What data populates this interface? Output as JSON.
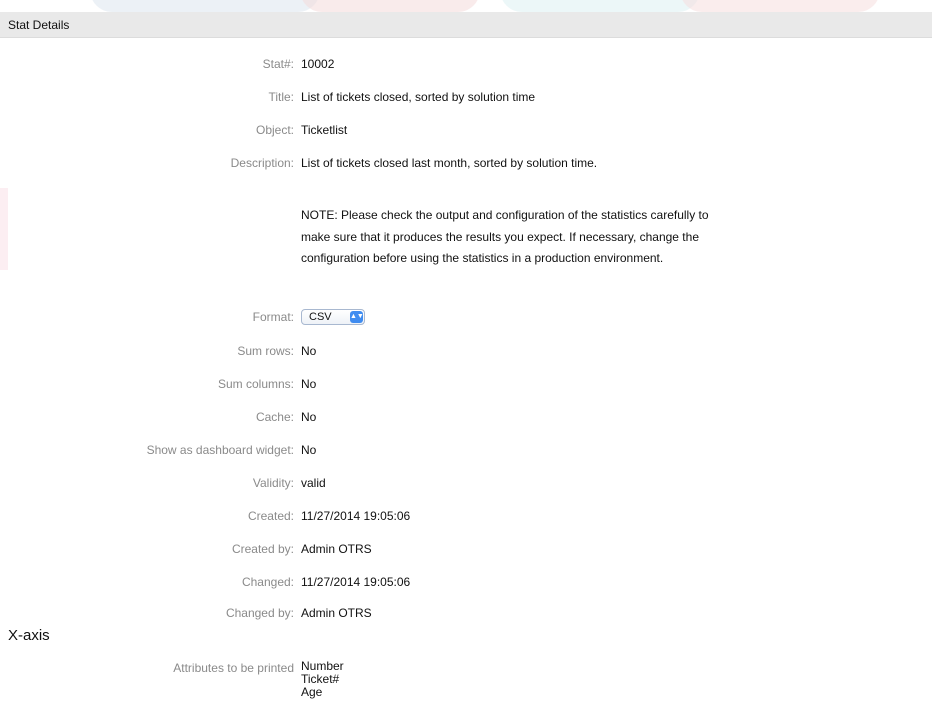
{
  "header": {
    "title": "Stat Details"
  },
  "fields": {
    "stat_number": {
      "label": "Stat#:",
      "value": "10002"
    },
    "title": {
      "label": "Title:",
      "value": "List of tickets closed, sorted by solution time"
    },
    "object": {
      "label": "Object:",
      "value": "Ticketlist"
    },
    "description": {
      "label": "Description:",
      "value": "List of tickets closed last month, sorted by solution time.",
      "note": "NOTE: Please check the output and configuration of the statistics carefully to make sure that it produces the results you expect. If necessary, change the configuration before using the statistics in a production environment."
    },
    "format": {
      "label": "Format:",
      "value": "CSV"
    },
    "sum_rows": {
      "label": "Sum rows:",
      "value": "No"
    },
    "sum_columns": {
      "label": "Sum columns:",
      "value": "No"
    },
    "cache": {
      "label": "Cache:",
      "value": "No"
    },
    "dashboard_widget": {
      "label": "Show as dashboard widget:",
      "value": "No"
    },
    "validity": {
      "label": "Validity:",
      "value": "valid"
    },
    "created": {
      "label": "Created:",
      "value": "11/27/2014 19:05:06"
    },
    "created_by": {
      "label": "Created by:",
      "value": "Admin OTRS"
    },
    "changed": {
      "label": "Changed:",
      "value": "11/27/2014 19:05:06"
    },
    "changed_by": {
      "label": "Changed by:",
      "value": "Admin OTRS"
    }
  },
  "xaxis": {
    "heading": "X-axis",
    "attributes_label": "Attributes to be printed",
    "attributes": [
      "Number",
      "Ticket#",
      "Age"
    ]
  },
  "icons": {
    "format_arrow": "select-arrows-icon"
  },
  "colors": {
    "header_bg": "#e9e9e9",
    "label": "#8a8a8a",
    "select_accent": "#3f8cf0"
  }
}
